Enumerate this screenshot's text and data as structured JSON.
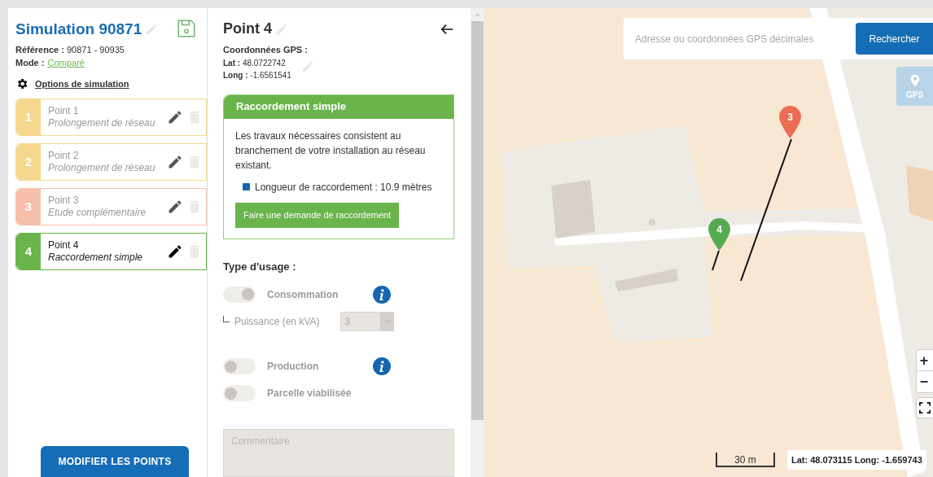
{
  "simulation": {
    "title": "Simulation 90871",
    "reference_label": "Référence :",
    "reference": "90871 - 90935",
    "mode_label": "Mode :",
    "mode": "Comparé",
    "options_link": "Options de simulation"
  },
  "points": [
    {
      "number": "1",
      "title": "Point 1",
      "subtitle": "Prolongement de réseau",
      "color": "#f5d88e",
      "selected": false
    },
    {
      "number": "2",
      "title": "Point 2",
      "subtitle": "Prolongement de réseau",
      "color": "#f5d88e",
      "selected": false
    },
    {
      "number": "3",
      "title": "Point 3",
      "subtitle": "Etude complémentaire",
      "color": "#f7bfaa",
      "selected": false
    },
    {
      "number": "4",
      "title": "Point 4",
      "subtitle": "Raccordement simple",
      "color": "#6ab44c",
      "selected": true
    }
  ],
  "modify_button": "MODIFIER LES POINTS",
  "detail": {
    "title": "Point 4",
    "gps_label": "Coordonnées GPS :",
    "lat_label": "Lat :",
    "lat": "48.0722742",
    "long_label": "Long :",
    "long": "-1.6561541",
    "result": {
      "title": "Raccordement simple",
      "text": "Les travaux nécessaires consistent au branchement de votre installation au réseau existant.",
      "length": "Longueur de raccordement : 10.9 mètres",
      "button": "Faire une demande de raccordement"
    },
    "usage_title": "Type d'usage :",
    "usages": [
      {
        "kind": "toggle",
        "label": "Consommation",
        "on": true,
        "info": true
      },
      {
        "kind": "select",
        "label": "Puissance (en kVA)",
        "value": "3"
      },
      {
        "kind": "toggle",
        "label": "Production",
        "on": false,
        "info": true
      },
      {
        "kind": "toggle",
        "label": "Parcelle viabilisée",
        "on": false,
        "info": false
      }
    ],
    "comment_placeholder": "Commentaire"
  },
  "map": {
    "search_placeholder": "Adresse ou coordonnées GPS décimales",
    "search_button": "Rechercher",
    "gps_button": "GPS",
    "markers": [
      {
        "label": "3",
        "color": "#ea6d54"
      },
      {
        "label": "4",
        "color": "#55ac50"
      }
    ],
    "zoom_in": "+",
    "zoom_out": "−",
    "scale": "30 m",
    "coordinates": "Lat: 48.073115 Long: -1.659743"
  }
}
